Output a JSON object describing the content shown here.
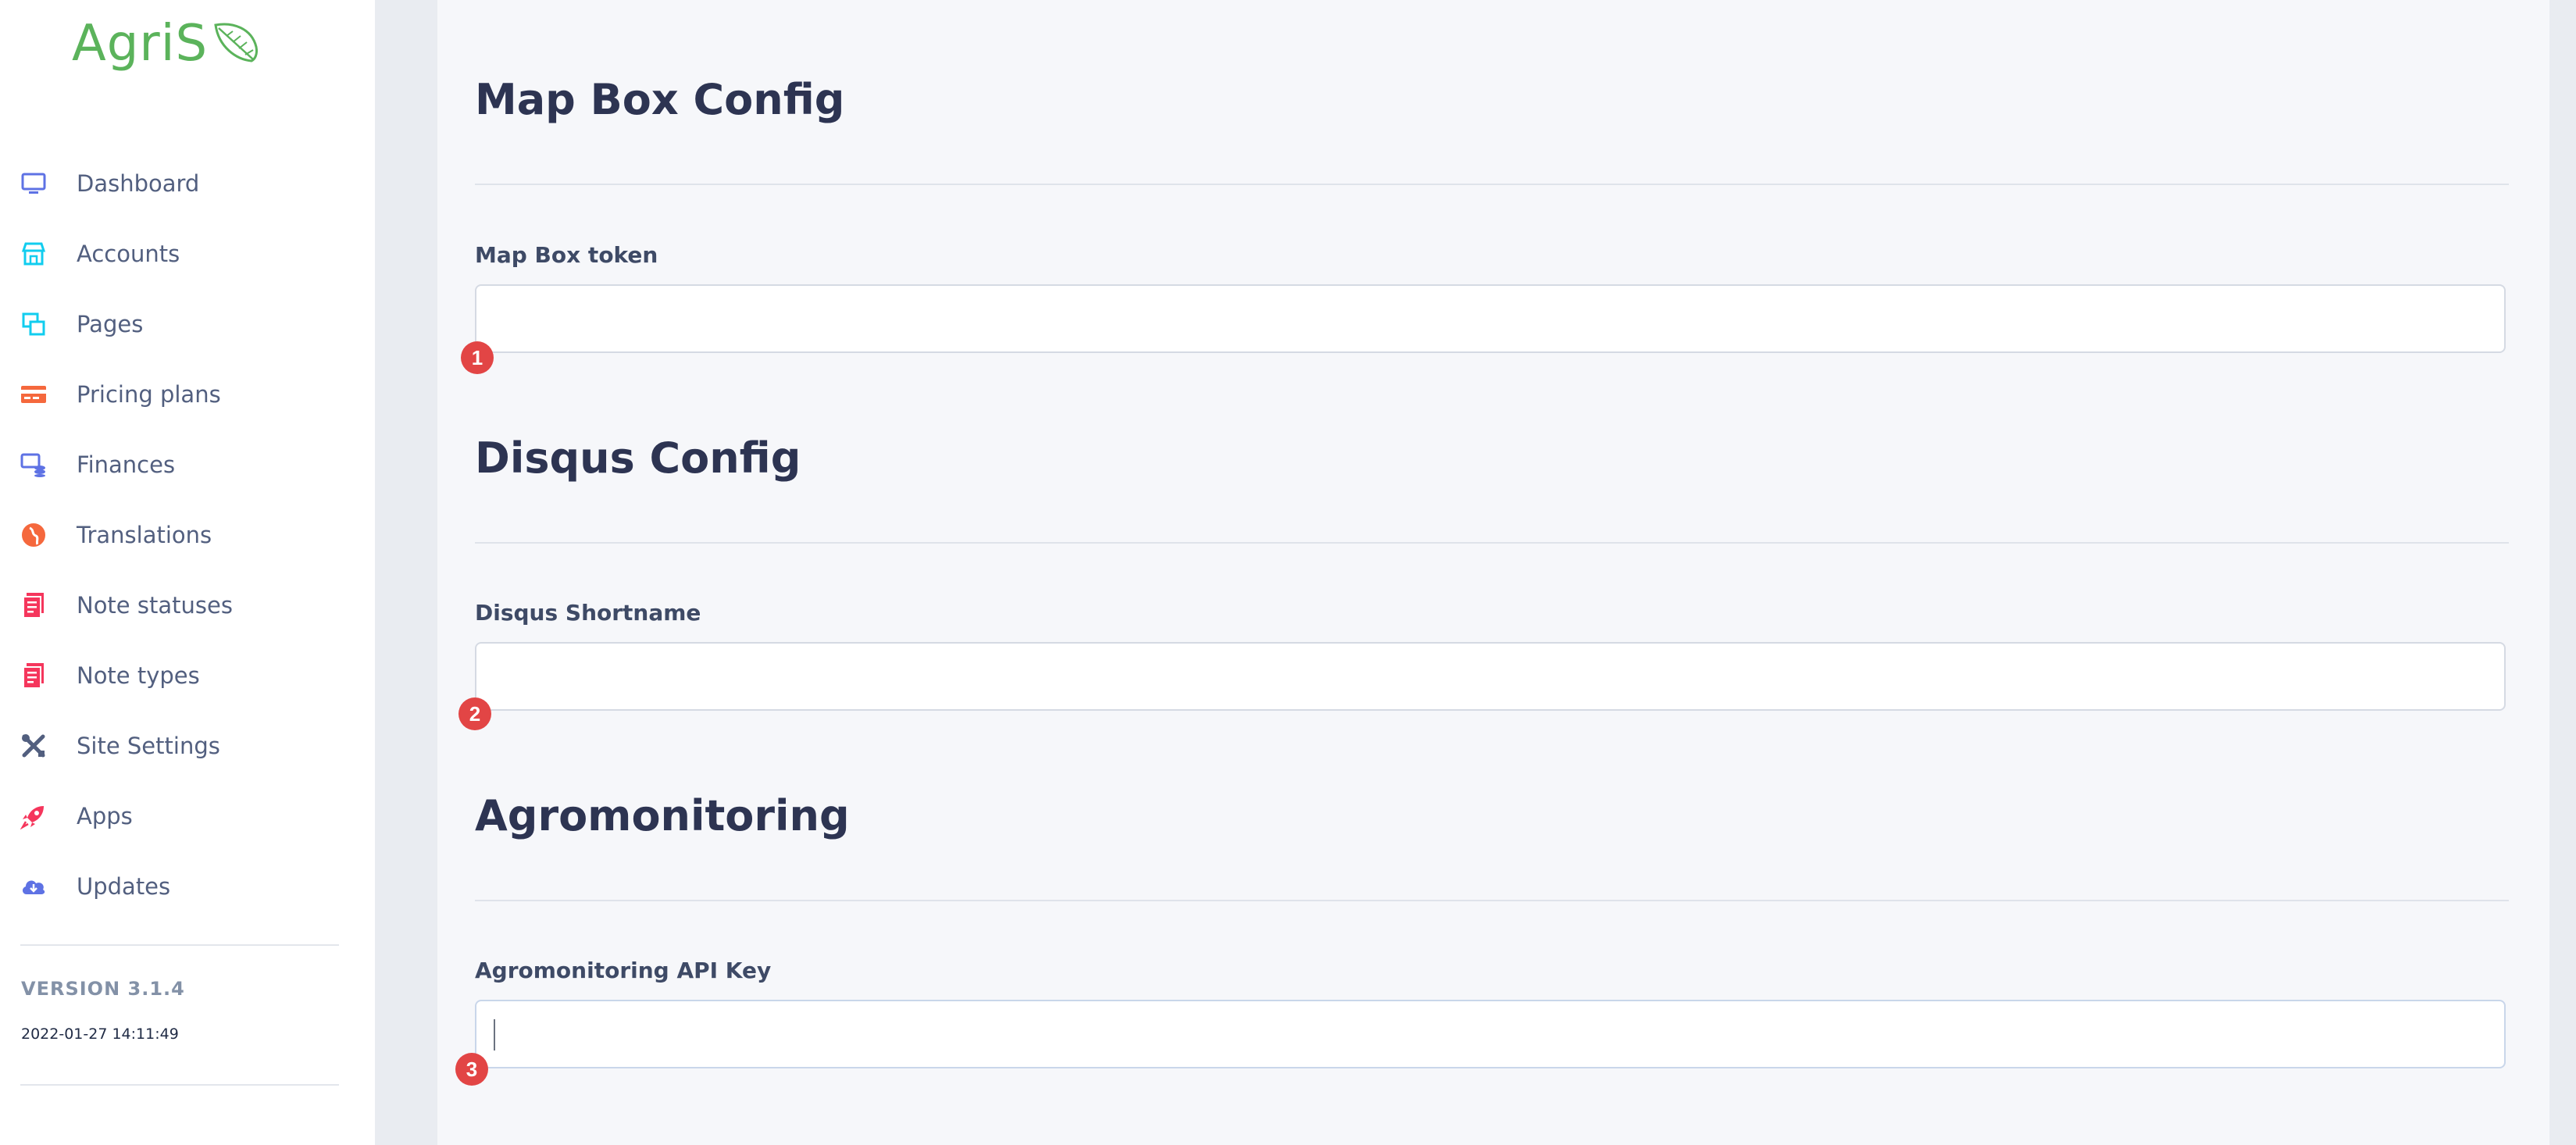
{
  "brand": {
    "name": "AgriS",
    "logo_icon": "leaf-icon",
    "color": "#5bb35b"
  },
  "sidebar": {
    "items": [
      {
        "label": "Dashboard",
        "icon": "monitor-icon",
        "color": "#5e72e4"
      },
      {
        "label": "Accounts",
        "icon": "store-icon",
        "color": "#11cdef"
      },
      {
        "label": "Pages",
        "icon": "pages-icon",
        "color": "#11cdef"
      },
      {
        "label": "Pricing plans",
        "icon": "credit-card-icon",
        "color": "#f5683d"
      },
      {
        "label": "Finances",
        "icon": "finance-icon",
        "color": "#5e72e4"
      },
      {
        "label": "Translations",
        "icon": "globe-icon",
        "color": "#f5683d"
      },
      {
        "label": "Note statuses",
        "icon": "note-icon",
        "color": "#f5365c"
      },
      {
        "label": "Note types",
        "icon": "note-icon",
        "color": "#f5365c"
      },
      {
        "label": "Site Settings",
        "icon": "tools-icon",
        "color": "#525f7f"
      },
      {
        "label": "Apps",
        "icon": "rocket-icon",
        "color": "#f5365c"
      },
      {
        "label": "Updates",
        "icon": "cloud-download-icon",
        "color": "#5e72e4"
      }
    ],
    "version": "VERSION 3.1.4",
    "build_date": "2022-01-27 14:11:49"
  },
  "main": {
    "sections": [
      {
        "title": "Map Box Config",
        "field_label": "Map Box token",
        "value": "",
        "badge": "1"
      },
      {
        "title": "Disqus Config",
        "field_label": "Disqus Shortname",
        "value": "",
        "badge": "2"
      },
      {
        "title": "Agromonitoring",
        "field_label": "Agromonitoring API Key",
        "value": "",
        "badge": "3"
      }
    ]
  },
  "colors": {
    "badge": "#e24545",
    "heading": "#2d3452"
  }
}
